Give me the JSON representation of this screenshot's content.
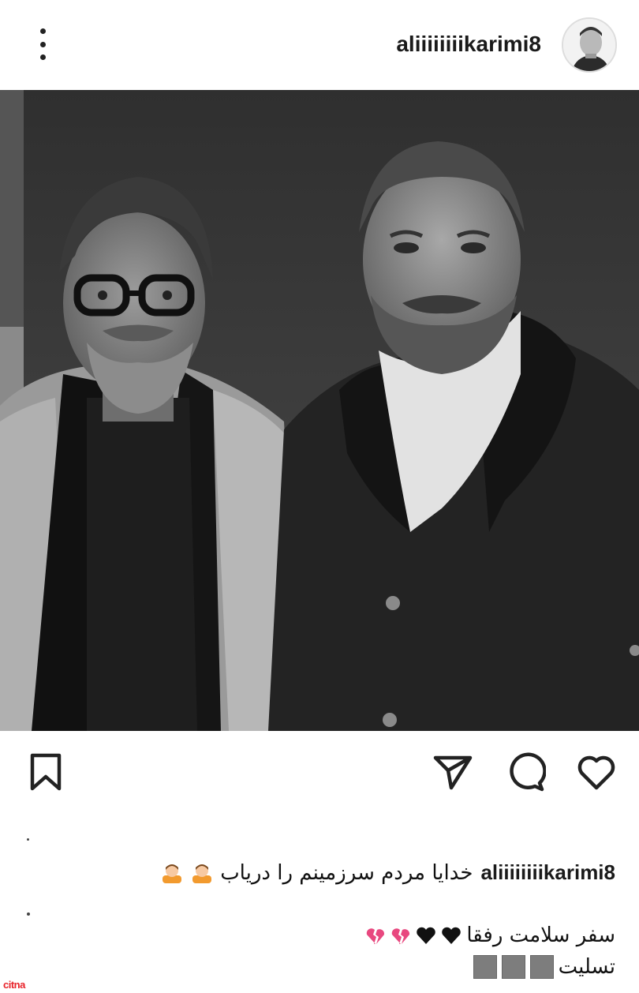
{
  "post": {
    "username": "aliiiiiiiikarimi8",
    "avatar_icon": "profile-photo",
    "more_icon": "more-vertical-icon"
  },
  "actions": {
    "bookmark_icon": "bookmark-icon",
    "share_icon": "send-icon",
    "comment_icon": "comment-icon",
    "like_icon": "heart-icon"
  },
  "caption": {
    "username": "aliiiiiiiikarimi8",
    "line1": "خدایا مردم سرزمینم را دریاب",
    "line2": "سفر سلامت رفقا",
    "line3": "تسلیت"
  },
  "colors": {
    "broken_heart": "#e8487f",
    "black_heart": "#111111",
    "placeholder_square": "#7d7d7d"
  },
  "watermark": {
    "text": "citna"
  }
}
